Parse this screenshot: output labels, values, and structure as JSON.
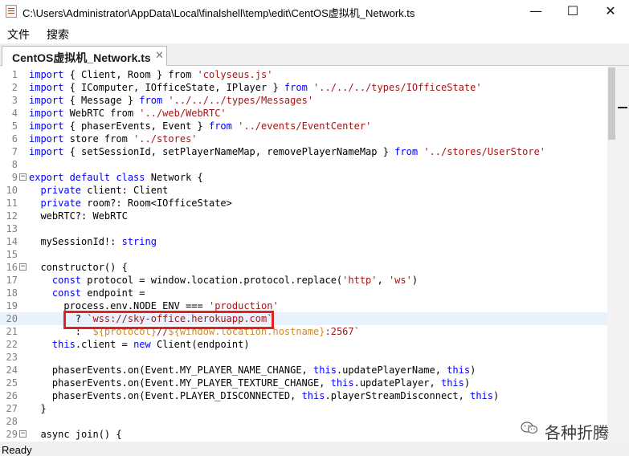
{
  "window": {
    "title": "C:\\Users\\Administrator\\AppData\\Local\\finalshell\\temp\\edit\\CentOS虚拟机_Network.ts",
    "icon": "java-cup-icon",
    "controls": {
      "minimize": "—",
      "maximize": "☐",
      "close": "✕"
    }
  },
  "menu": {
    "file": "文件",
    "search": "搜索"
  },
  "tab": {
    "label": "CentOS虚拟机_Network.ts",
    "close": "✕"
  },
  "code": {
    "highlighted_line": 20,
    "lines": [
      {
        "n": "1",
        "segs": [
          {
            "t": "import",
            "c": "kw"
          },
          {
            "t": " { Client, Room } from "
          },
          {
            "t": "'colyseus.js'",
            "c": "str"
          }
        ]
      },
      {
        "n": "2",
        "segs": [
          {
            "t": "import",
            "c": "kw"
          },
          {
            "t": " { IComputer, IOfficeState, IPlayer } "
          },
          {
            "t": "from",
            "c": "kw"
          },
          {
            "t": " "
          },
          {
            "t": "'../../../types/IOfficeState'",
            "c": "str"
          }
        ]
      },
      {
        "n": "3",
        "segs": [
          {
            "t": "import",
            "c": "kw"
          },
          {
            "t": " { Message } "
          },
          {
            "t": "from",
            "c": "kw"
          },
          {
            "t": " "
          },
          {
            "t": "'../../../types/Messages'",
            "c": "str"
          }
        ]
      },
      {
        "n": "4",
        "segs": [
          {
            "t": "import",
            "c": "kw"
          },
          {
            "t": " WebRTC from "
          },
          {
            "t": "'../web/WebRTC'",
            "c": "str"
          }
        ]
      },
      {
        "n": "5",
        "segs": [
          {
            "t": "import",
            "c": "kw"
          },
          {
            "t": " { phaserEvents, Event } "
          },
          {
            "t": "from",
            "c": "kw"
          },
          {
            "t": " "
          },
          {
            "t": "'../events/EventCenter'",
            "c": "str"
          }
        ]
      },
      {
        "n": "6",
        "segs": [
          {
            "t": "import",
            "c": "kw"
          },
          {
            "t": " store from "
          },
          {
            "t": "'../stores'",
            "c": "str"
          }
        ]
      },
      {
        "n": "7",
        "segs": [
          {
            "t": "import",
            "c": "kw"
          },
          {
            "t": " { setSessionId, setPlayerNameMap, removePlayerNameMap } "
          },
          {
            "t": "from",
            "c": "kw"
          },
          {
            "t": " "
          },
          {
            "t": "'../stores/UserStore'",
            "c": "str"
          }
        ]
      },
      {
        "n": "8",
        "segs": []
      },
      {
        "n": "9",
        "fold": "−",
        "segs": [
          {
            "t": "export default class",
            "c": "kw"
          },
          {
            "t": " Network {"
          }
        ]
      },
      {
        "n": "10",
        "segs": [
          {
            "t": "  "
          },
          {
            "t": "private",
            "c": "kw"
          },
          {
            "t": " client: Client"
          }
        ]
      },
      {
        "n": "11",
        "segs": [
          {
            "t": "  "
          },
          {
            "t": "private",
            "c": "kw"
          },
          {
            "t": " room?: Room<IOfficeState>"
          }
        ]
      },
      {
        "n": "12",
        "segs": [
          {
            "t": "  webRTC?: WebRTC"
          }
        ]
      },
      {
        "n": "13",
        "segs": []
      },
      {
        "n": "14",
        "segs": [
          {
            "t": "  mySessionId!: "
          },
          {
            "t": "string",
            "c": "kw"
          }
        ]
      },
      {
        "n": "15",
        "segs": []
      },
      {
        "n": "16",
        "fold": "−",
        "segs": [
          {
            "t": "  constructor() {"
          }
        ]
      },
      {
        "n": "17",
        "segs": [
          {
            "t": "    "
          },
          {
            "t": "const",
            "c": "kw"
          },
          {
            "t": " protocol = window.location.protocol.replace("
          },
          {
            "t": "'http'",
            "c": "str"
          },
          {
            "t": ", "
          },
          {
            "t": "'ws'",
            "c": "str"
          },
          {
            "t": ")"
          }
        ]
      },
      {
        "n": "18",
        "segs": [
          {
            "t": "    "
          },
          {
            "t": "const",
            "c": "kw"
          },
          {
            "t": " endpoint ="
          }
        ]
      },
      {
        "n": "19",
        "segs": [
          {
            "t": "      process.env.NODE_ENV === "
          },
          {
            "t": "'production'",
            "c": "str"
          }
        ]
      },
      {
        "n": "20",
        "segs": [
          {
            "t": "        ? "
          },
          {
            "t": "`wss://sky-office.herokuapp.com`",
            "c": "str"
          }
        ]
      },
      {
        "n": "21",
        "segs": [
          {
            "t": "        : "
          },
          {
            "t": "`",
            "c": "str"
          },
          {
            "t": "${protocol}",
            "c": "interp"
          },
          {
            "t": "//",
            "c": "str"
          },
          {
            "t": "${window.location.hostname}",
            "c": "interp"
          },
          {
            "t": ":2567`",
            "c": "str"
          }
        ]
      },
      {
        "n": "22",
        "segs": [
          {
            "t": "    "
          },
          {
            "t": "this",
            "c": "kw"
          },
          {
            "t": ".client = "
          },
          {
            "t": "new",
            "c": "kw"
          },
          {
            "t": " Client(endpoint)"
          }
        ]
      },
      {
        "n": "23",
        "segs": []
      },
      {
        "n": "24",
        "segs": [
          {
            "t": "    phaserEvents.on(Event.MY_PLAYER_NAME_CHANGE, "
          },
          {
            "t": "this",
            "c": "kw"
          },
          {
            "t": ".updatePlayerName, "
          },
          {
            "t": "this",
            "c": "kw"
          },
          {
            "t": ")"
          }
        ]
      },
      {
        "n": "25",
        "segs": [
          {
            "t": "    phaserEvents.on(Event.MY_PLAYER_TEXTURE_CHANGE, "
          },
          {
            "t": "this",
            "c": "kw"
          },
          {
            "t": ".updatePlayer, "
          },
          {
            "t": "this",
            "c": "kw"
          },
          {
            "t": ")"
          }
        ]
      },
      {
        "n": "26",
        "segs": [
          {
            "t": "    phaserEvents.on(Event.PLAYER_DISCONNECTED, "
          },
          {
            "t": "this",
            "c": "kw"
          },
          {
            "t": ".playerStreamDisconnect, "
          },
          {
            "t": "this",
            "c": "kw"
          },
          {
            "t": ")"
          }
        ]
      },
      {
        "n": "27",
        "segs": [
          {
            "t": "  }"
          }
        ]
      },
      {
        "n": "28",
        "segs": []
      },
      {
        "n": "29",
        "fold": "−",
        "segs": [
          {
            "t": "  async join() {"
          }
        ]
      }
    ]
  },
  "status": {
    "text": "Ready"
  },
  "watermark": {
    "text": "各种折腾",
    "icon": "wechat-icon"
  }
}
